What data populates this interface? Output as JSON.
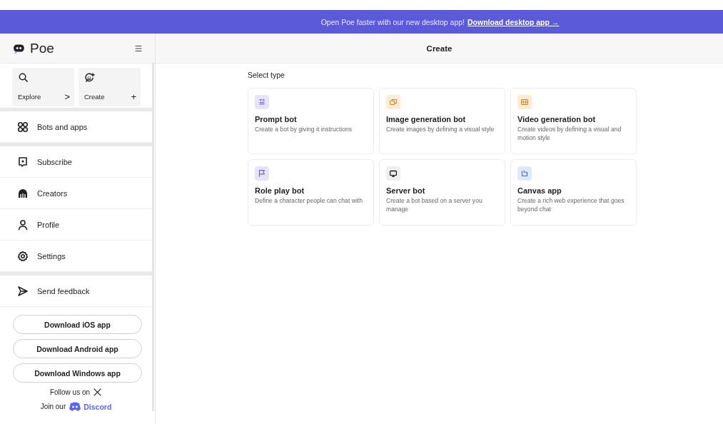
{
  "banner": {
    "message": "Open Poe faster with our new desktop app!",
    "link": "Download desktop app →"
  },
  "sidebar": {
    "logo": "Poe",
    "quick_actions": [
      {
        "label": "Explore",
        "trailing": ">"
      },
      {
        "label": "Create",
        "trailing": "+"
      }
    ],
    "menu_groups": [
      [
        {
          "label": "Bots and apps"
        }
      ],
      [
        {
          "label": "Subscribe"
        },
        {
          "label": "Creators"
        },
        {
          "label": "Profile"
        },
        {
          "label": "Settings"
        }
      ],
      [
        {
          "label": "Send feedback"
        }
      ]
    ],
    "download_buttons": [
      "Download iOS app",
      "Download Android app",
      "Download Windows app"
    ],
    "follow": "Follow us on",
    "join": "Join our",
    "discord": "Discord"
  },
  "main": {
    "title": "Create",
    "section_label": "Select type",
    "types": [
      {
        "title": "Prompt bot",
        "description": "Create a bot by giving it instructions",
        "color": "#e6e3fb"
      },
      {
        "title": "Image generation bot",
        "description": "Create images by defining a visual style",
        "color": "#fdebd3"
      },
      {
        "title": "Video generation bot",
        "description": "Create videos by defining a visual and motion style",
        "color": "#fdebd3"
      },
      {
        "title": "Role play bot",
        "description": "Define a character people can chat with",
        "color": "#e6e3fb"
      },
      {
        "title": "Server bot",
        "description": "Create a bot based on a server you manage",
        "color": "#efefef"
      },
      {
        "title": "Canvas app",
        "description": "Create a rich web experience that goes beyond chat",
        "color": "#e1e8fb"
      }
    ]
  }
}
